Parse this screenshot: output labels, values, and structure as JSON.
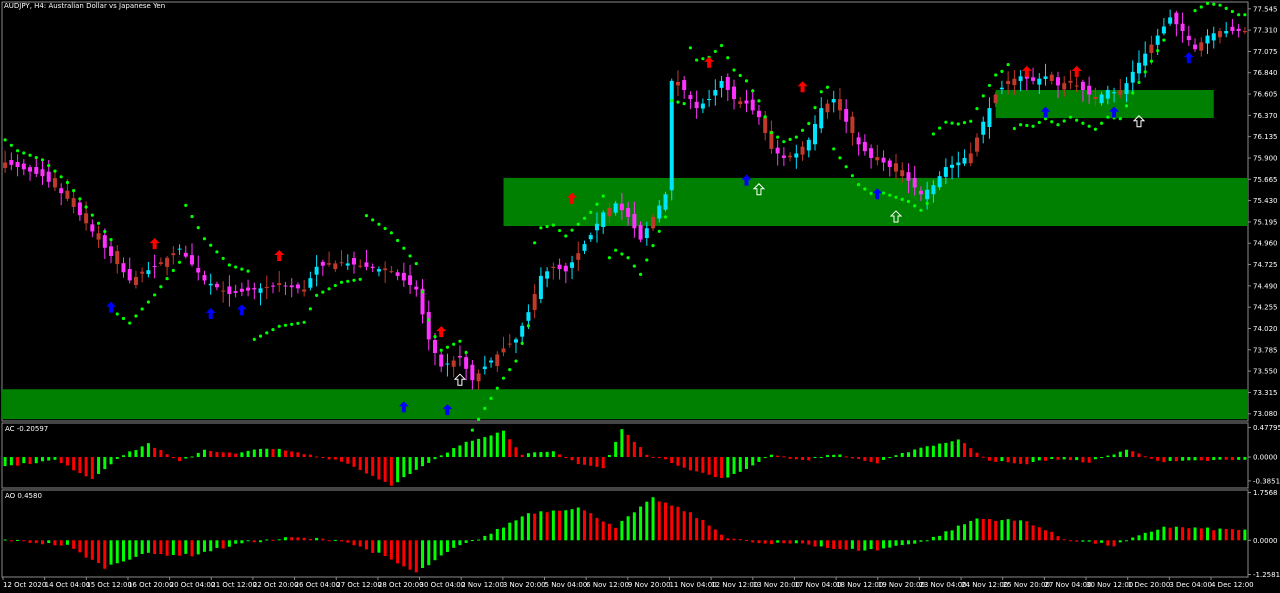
{
  "window_title": "AUDJPY, H4:  Australian Dollar vs Japanese Yen",
  "colors": {
    "background": "#000000",
    "zone": "#008000",
    "bull_candle": "#00e5ff",
    "bear_candle": "#ff33ff",
    "neutral_candle": "#c0392b",
    "sar_dot": "#00ff00",
    "up_arrow": "#0000ff",
    "down_arrow": "#ff0000",
    "hollow_arrow": "#ffffff",
    "hist_up": "#00ff00",
    "hist_down": "#ff0000"
  },
  "chart_data": [
    {
      "type": "candlestick",
      "symbol": "AUDJPY",
      "timeframe": "H4",
      "title": "AUDJPY, H4:  Australian Dollar vs Japanese Yen",
      "y_ticks": [
        "77.545",
        "77.310",
        "77.075",
        "76.840",
        "76.605",
        "76.370",
        "76.135",
        "75.900",
        "75.665",
        "75.430",
        "75.195",
        "74.960",
        "74.725",
        "74.490",
        "74.255",
        "74.020",
        "73.785",
        "73.550",
        "73.315",
        "73.080"
      ],
      "ylim": [
        73.0,
        77.62
      ],
      "x_labels": [
        "12 Oct 2020",
        "14 Oct 04:00",
        "15 Oct 12:00",
        "16 Oct 20:00",
        "20 Oct 04:00",
        "21 Oct 12:00",
        "22 Oct 20:00",
        "26 Oct 04:00",
        "27 Oct 12:00",
        "28 Oct 20:00",
        "30 Oct 04:00",
        "2 Nov 12:00",
        "3 Nov 20:00",
        "5 Nov 04:00",
        "6 Nov 12:00",
        "9 Nov 20:00",
        "11 Nov 04:00",
        "12 Nov 12:00",
        "13 Nov 20:00",
        "17 Nov 04:00",
        "18 Nov 12:00",
        "19 Nov 20:00",
        "23 Nov 04:00",
        "24 Nov 12:00",
        "25 Nov 20:00",
        "27 Nov 04:00",
        "30 Nov 12:00",
        "1 Dec 20:00",
        "3 Dec 04:00",
        "4 Dec 12:00"
      ],
      "path_close": [
        [
          0,
          75.85
        ],
        [
          6,
          75.7
        ],
        [
          10,
          75.45
        ],
        [
          15,
          75.0
        ],
        [
          20,
          74.55
        ],
        [
          24,
          74.7
        ],
        [
          28,
          74.9
        ],
        [
          32,
          74.55
        ],
        [
          36,
          74.4
        ],
        [
          40,
          74.45
        ],
        [
          44,
          74.5
        ],
        [
          48,
          74.45
        ],
        [
          50,
          74.7
        ],
        [
          54,
          74.75
        ],
        [
          58,
          74.7
        ],
        [
          62,
          74.65
        ],
        [
          66,
          74.45
        ],
        [
          68,
          73.9
        ],
        [
          70,
          73.6
        ],
        [
          73,
          73.7
        ],
        [
          75,
          73.45
        ],
        [
          77,
          73.6
        ],
        [
          80,
          73.8
        ],
        [
          82,
          73.9
        ],
        [
          84,
          74.2
        ],
        [
          86,
          74.6
        ],
        [
          88,
          74.7
        ],
        [
          90,
          74.65
        ],
        [
          92,
          74.85
        ],
        [
          94,
          75.05
        ],
        [
          96,
          75.3
        ],
        [
          98,
          75.4
        ],
        [
          100,
          75.25
        ],
        [
          102,
          75.0
        ],
        [
          104,
          75.25
        ],
        [
          106,
          75.5
        ],
        [
          107,
          76.75
        ],
        [
          109,
          76.65
        ],
        [
          111,
          76.45
        ],
        [
          113,
          76.55
        ],
        [
          115,
          76.75
        ],
        [
          117,
          76.55
        ],
        [
          119,
          76.5
        ],
        [
          121,
          76.35
        ],
        [
          123,
          76.0
        ],
        [
          125,
          75.9
        ],
        [
          127,
          75.95
        ],
        [
          129,
          76.1
        ],
        [
          131,
          76.45
        ],
        [
          133,
          76.55
        ],
        [
          135,
          76.3
        ],
        [
          137,
          76.05
        ],
        [
          139,
          75.9
        ],
        [
          141,
          75.85
        ],
        [
          143,
          75.75
        ],
        [
          145,
          75.65
        ],
        [
          147,
          75.5
        ],
        [
          149,
          75.6
        ],
        [
          151,
          75.8
        ],
        [
          153,
          75.85
        ],
        [
          155,
          75.95
        ],
        [
          157,
          76.3
        ],
        [
          159,
          76.6
        ],
        [
          161,
          76.75
        ],
        [
          163,
          76.8
        ],
        [
          165,
          76.75
        ],
        [
          167,
          76.8
        ],
        [
          169,
          76.7
        ],
        [
          171,
          76.75
        ],
        [
          173,
          76.65
        ],
        [
          175,
          76.55
        ],
        [
          177,
          76.65
        ],
        [
          179,
          76.6
        ],
        [
          181,
          76.85
        ],
        [
          183,
          77.05
        ],
        [
          185,
          77.25
        ],
        [
          187,
          77.45
        ],
        [
          189,
          77.3
        ],
        [
          191,
          77.1
        ],
        [
          193,
          77.25
        ],
        [
          195,
          77.3
        ]
      ],
      "trend_breaks": [
        36,
        82,
        107,
        147,
        181
      ],
      "sar_up_segments": [
        [
          18,
          28
        ],
        [
          40,
          57
        ],
        [
          75,
          84
        ],
        [
          97,
          109
        ],
        [
          133,
          148
        ],
        [
          162,
          186
        ]
      ],
      "down_arrows": [
        [
          24,
          74.95
        ],
        [
          44,
          74.82
        ],
        [
          70,
          73.98
        ],
        [
          91,
          75.45
        ],
        [
          113,
          76.95
        ],
        [
          128,
          76.68
        ],
        [
          164,
          76.85
        ],
        [
          172,
          76.85
        ]
      ],
      "up_arrows": [
        [
          17,
          74.25
        ],
        [
          33,
          74.18
        ],
        [
          38,
          74.22
        ],
        [
          64,
          73.15
        ],
        [
          71,
          73.12
        ],
        [
          119,
          75.65
        ],
        [
          140,
          75.5
        ],
        [
          167,
          76.4
        ],
        [
          178,
          76.4
        ],
        [
          190,
          77.0
        ]
      ],
      "hollow_arrows": [
        [
          73,
          73.45
        ],
        [
          121,
          75.55
        ],
        [
          143,
          75.25
        ],
        [
          182,
          76.3
        ]
      ],
      "zones": [
        {
          "x0": 80.5,
          "x1": 200,
          "low": 75.15,
          "high": 75.68
        },
        {
          "x0": 159.5,
          "x1": 194.5,
          "low": 76.34,
          "high": 76.65
        },
        {
          "x0": 0,
          "x1": 200,
          "low": 73.02,
          "high": 73.35
        }
      ]
    },
    {
      "type": "histogram",
      "name": "AC",
      "header": "AC -0.20597",
      "y_ticks": [
        "0.47795",
        "0.0000",
        "-0.38517"
      ],
      "ylim": [
        -0.5,
        0.55
      ],
      "path": [
        [
          0,
          -0.15
        ],
        [
          8,
          -0.05
        ],
        [
          14,
          -0.35
        ],
        [
          18,
          -0.02
        ],
        [
          23,
          0.22
        ],
        [
          28,
          -0.08
        ],
        [
          32,
          0.12
        ],
        [
          37,
          0.05
        ],
        [
          42,
          0.15
        ],
        [
          48,
          0.05
        ],
        [
          54,
          -0.06
        ],
        [
          62,
          -0.45
        ],
        [
          68,
          -0.1
        ],
        [
          74,
          0.25
        ],
        [
          80,
          0.42
        ],
        [
          83,
          0.05
        ],
        [
          88,
          0.08
        ],
        [
          92,
          -0.1
        ],
        [
          96,
          -0.18
        ],
        [
          99,
          0.45
        ],
        [
          103,
          0.05
        ],
        [
          106,
          -0.05
        ],
        [
          110,
          -0.2
        ],
        [
          115,
          -0.35
        ],
        [
          118,
          -0.25
        ],
        [
          123,
          0.05
        ],
        [
          128,
          -0.06
        ],
        [
          133,
          0.05
        ],
        [
          140,
          -0.1
        ],
        [
          146,
          0.13
        ],
        [
          153,
          0.28
        ],
        [
          158,
          -0.05
        ],
        [
          163,
          -0.12
        ],
        [
          168,
          -0.03
        ],
        [
          174,
          -0.08
        ],
        [
          180,
          0.12
        ],
        [
          186,
          -0.08
        ],
        [
          195,
          -0.05
        ]
      ]
    },
    {
      "type": "histogram",
      "name": "AO",
      "header": "AO 0.4580",
      "y_ticks": [
        "1.7568",
        "0.0000",
        "-1.2581"
      ],
      "ylim": [
        -1.35,
        1.85
      ],
      "path": [
        [
          0,
          0.02
        ],
        [
          10,
          -0.2
        ],
        [
          16,
          -1.0
        ],
        [
          22,
          -0.5
        ],
        [
          30,
          -0.55
        ],
        [
          38,
          -0.1
        ],
        [
          46,
          0.1
        ],
        [
          54,
          0.0
        ],
        [
          60,
          -0.5
        ],
        [
          66,
          -1.2
        ],
        [
          72,
          -0.3
        ],
        [
          78,
          0.25
        ],
        [
          84,
          1.0
        ],
        [
          92,
          1.2
        ],
        [
          98,
          0.5
        ],
        [
          104,
          1.55
        ],
        [
          110,
          1.0
        ],
        [
          116,
          0.1
        ],
        [
          122,
          -0.15
        ],
        [
          128,
          -0.1
        ],
        [
          134,
          -0.35
        ],
        [
          140,
          -0.35
        ],
        [
          148,
          0.0
        ],
        [
          156,
          0.8
        ],
        [
          164,
          0.7
        ],
        [
          170,
          0.05
        ],
        [
          178,
          -0.2
        ],
        [
          186,
          0.5
        ],
        [
          195,
          0.4
        ]
      ]
    }
  ]
}
